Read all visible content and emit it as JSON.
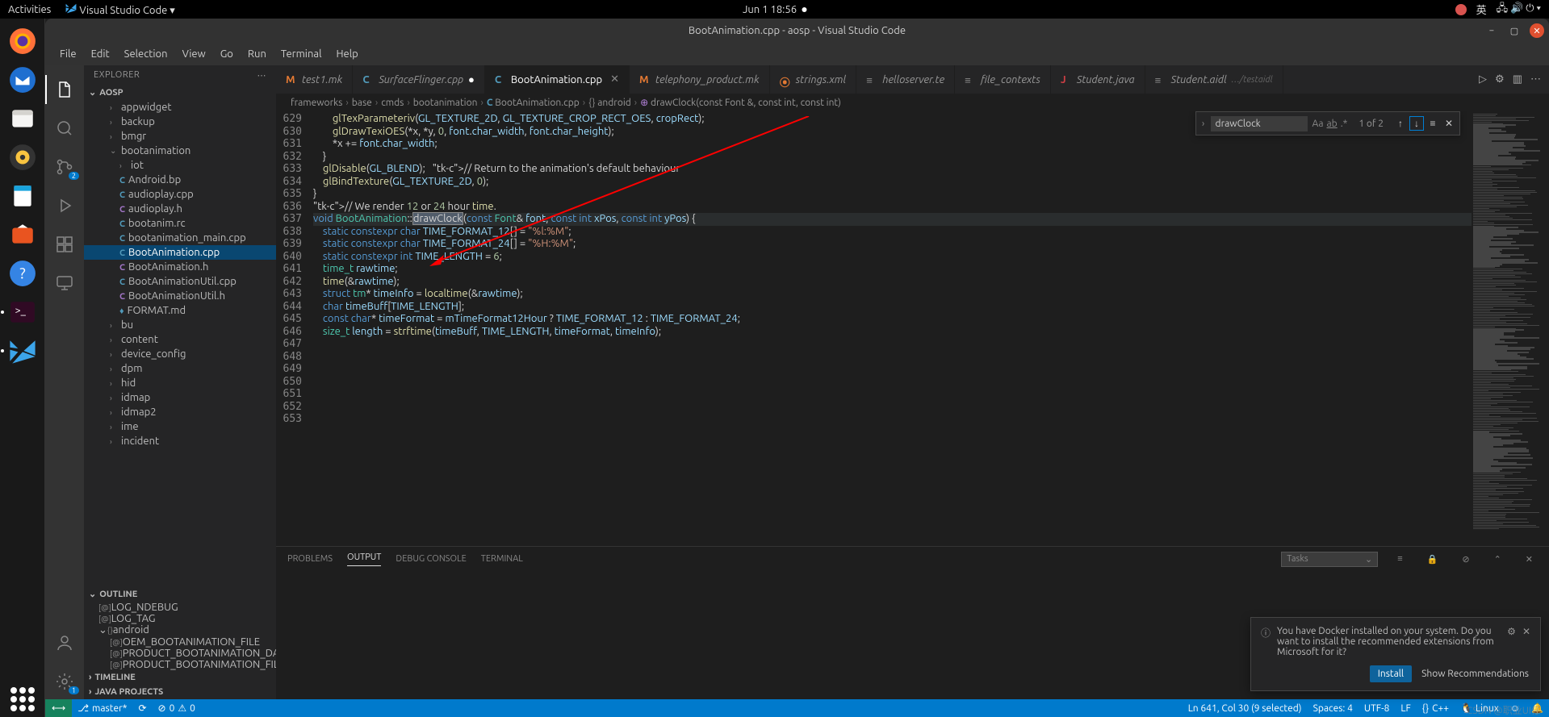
{
  "gnome": {
    "activities": "Activities",
    "appname": "Visual Studio Code ▾",
    "clock": "Jun 1  18:56",
    "ime": "英"
  },
  "window_title": "BootAnimation.cpp - aosp - Visual Studio Code",
  "menu": [
    "File",
    "Edit",
    "Selection",
    "View",
    "Go",
    "Run",
    "Terminal",
    "Help"
  ],
  "explorer": {
    "title": "EXPLORER",
    "section": "AOSP",
    "tree": [
      {
        "indent": 2,
        "caret": "›",
        "label": "appwidget"
      },
      {
        "indent": 2,
        "caret": "›",
        "label": "backup"
      },
      {
        "indent": 2,
        "caret": "›",
        "label": "bmgr"
      },
      {
        "indent": 2,
        "caret": "⌄",
        "label": "bootanimation"
      },
      {
        "indent": 3,
        "caret": "›",
        "label": "iot"
      },
      {
        "indent": 3,
        "icon": "c",
        "label": "Android.bp"
      },
      {
        "indent": 3,
        "icon": "c",
        "label": "audioplay.cpp"
      },
      {
        "indent": 3,
        "icon": "h",
        "label": "audioplay.h"
      },
      {
        "indent": 3,
        "icon": "c",
        "label": "bootanim.rc"
      },
      {
        "indent": 3,
        "icon": "c",
        "label": "bootanimation_main.cpp"
      },
      {
        "indent": 3,
        "icon": "c",
        "label": "BootAnimation.cpp",
        "sel": true
      },
      {
        "indent": 3,
        "icon": "h",
        "label": "BootAnimation.h"
      },
      {
        "indent": 3,
        "icon": "c",
        "label": "BootAnimationUtil.cpp"
      },
      {
        "indent": 3,
        "icon": "h",
        "label": "BootAnimationUtil.h"
      },
      {
        "indent": 3,
        "icon": "md",
        "label": "FORMAT.md"
      },
      {
        "indent": 2,
        "caret": "›",
        "label": "bu"
      },
      {
        "indent": 2,
        "caret": "›",
        "label": "content"
      },
      {
        "indent": 2,
        "caret": "›",
        "label": "device_config"
      },
      {
        "indent": 2,
        "caret": "›",
        "label": "dpm"
      },
      {
        "indent": 2,
        "caret": "›",
        "label": "hid"
      },
      {
        "indent": 2,
        "caret": "›",
        "label": "idmap"
      },
      {
        "indent": 2,
        "caret": "›",
        "label": "idmap2"
      },
      {
        "indent": 2,
        "caret": "›",
        "label": "ime"
      },
      {
        "indent": 2,
        "caret": "›",
        "label": "incident"
      }
    ],
    "outline": {
      "title": "OUTLINE",
      "items": [
        {
          "icon": "str",
          "label": "LOG_NDEBUG"
        },
        {
          "icon": "str",
          "label": "LOG_TAG"
        },
        {
          "icon": "ns",
          "label": "android",
          "open": true
        },
        {
          "icon": "str",
          "label": "OEM_BOOTANIMATION_FILE",
          "indent": 1
        },
        {
          "icon": "str",
          "label": "PRODUCT_BOOTANIMATION_DARK_…",
          "indent": 1
        },
        {
          "icon": "str",
          "label": "PRODUCT_BOOTANIMATION_FILE",
          "indent": 1
        }
      ]
    },
    "timeline": "TIMELINE",
    "javaprojects": "JAVA PROJECTS"
  },
  "tabs": [
    {
      "label": "test1.mk",
      "icon": "M",
      "color": "#e37933"
    },
    {
      "label": "SurfaceFlinger.cpp",
      "icon": "C",
      "color": "#519aba",
      "mod": true
    },
    {
      "label": "BootAnimation.cpp",
      "icon": "C",
      "color": "#519aba",
      "active": true,
      "close": true
    },
    {
      "label": "telephony_product.mk",
      "icon": "M",
      "color": "#e37933"
    },
    {
      "label": "strings.xml",
      "icon": "⦿",
      "color": "#e37933"
    },
    {
      "label": "helloserver.te",
      "icon": "≡",
      "color": "#888"
    },
    {
      "label": "file_contexts",
      "icon": "≡",
      "color": "#888"
    },
    {
      "label": "Student.java",
      "icon": "J",
      "color": "#cc3e44"
    },
    {
      "label": "Student.aidl",
      "icon": "≡",
      "color": "#888",
      "path": "…/testaidl"
    }
  ],
  "breadcrumb": [
    "frameworks",
    "base",
    "cmds",
    "bootanimation",
    "BootAnimation.cpp",
    "{} android",
    "drawClock(const Font &, const int, const int)"
  ],
  "find": {
    "value": "drawClock",
    "result": "1 of 2"
  },
  "code": {
    "start": 629,
    "lines": [
      "        glTexParameteriv(GL_TEXTURE_2D, GL_TEXTURE_CROP_RECT_OES, cropRect);",
      "",
      "        glDrawTexiOES(*x, *y, 0, font.char_width, font.char_height);",
      "",
      "        *x += font.char_width;",
      "    }",
      "",
      "    glDisable(GL_BLEND);   // Return to the animation's default behaviour",
      "    glBindTexture(GL_TEXTURE_2D, 0);",
      "}",
      "",
      "// We render 12 or 24 hour time.",
      "void BootAnimation::drawClock(const Font& font, const int xPos, const int yPos) {",
      "    static constexpr char TIME_FORMAT_12[] = \"%l:%M\";",
      "    static constexpr char TIME_FORMAT_24[] = \"%H:%M\";",
      "    static constexpr int TIME_LENGTH = 6;",
      "",
      "    time_t rawtime;",
      "    time(&rawtime);",
      "    struct tm* timeInfo = localtime(&rawtime);",
      "",
      "    char timeBuff[TIME_LENGTH];",
      "    const char* timeFormat = mTimeFormat12Hour ? TIME_FORMAT_12 : TIME_FORMAT_24;",
      "    size_t length = strftime(timeBuff, TIME_LENGTH, timeFormat, timeInfo);",
      ""
    ]
  },
  "panel": {
    "tabs": [
      "PROBLEMS",
      "OUTPUT",
      "DEBUG CONSOLE",
      "TERMINAL"
    ],
    "active": "OUTPUT",
    "tasks": "Tasks"
  },
  "toast": {
    "msg": "You have Docker installed on your system. Do you want to install the recommended extensions from Microsoft for it?",
    "install": "Install",
    "show": "Show Recommendations"
  },
  "status": {
    "branch": "master*",
    "errors": "0",
    "warnings": "0",
    "cursor": "Ln 641, Col 30 (9 selected)",
    "spaces": "Spaces: 4",
    "enc": "UTF-8",
    "eol": "LF",
    "lang": "C++",
    "os": "Linux"
  },
  "watermark": "CSDN @职业UI仔"
}
